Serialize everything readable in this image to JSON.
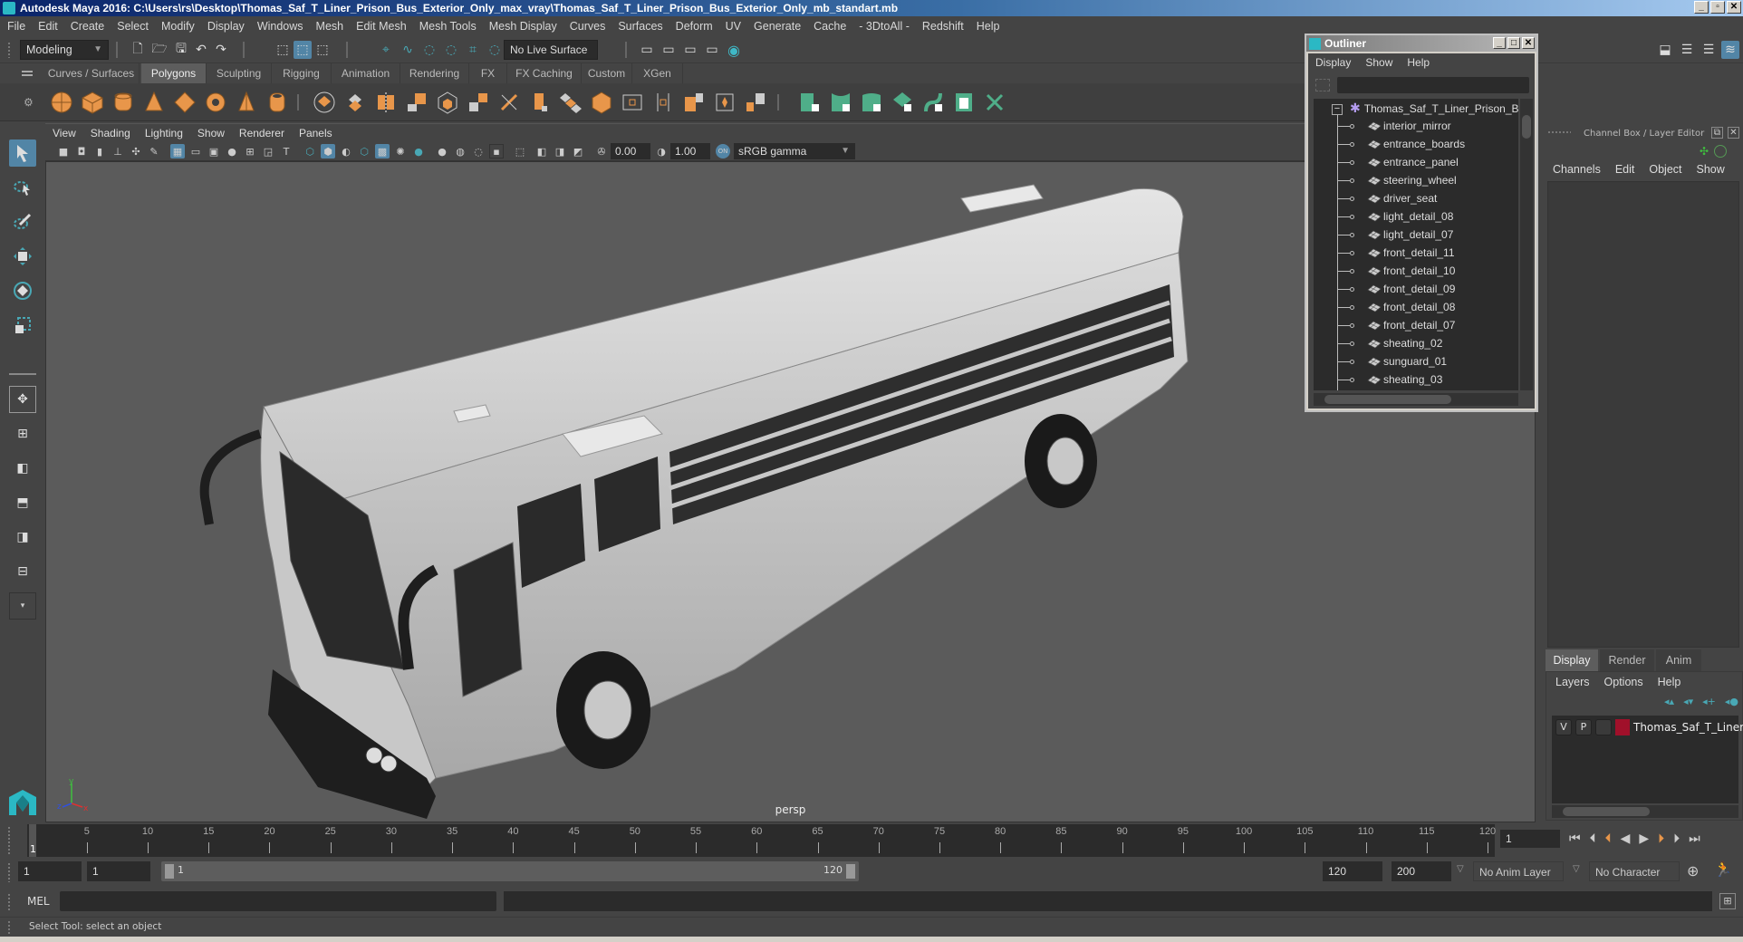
{
  "window": {
    "title": "Autodesk Maya 2016: C:\\Users\\rs\\Desktop\\Thomas_Saf_T_Liner_Prison_Bus_Exterior_Only_max_vray\\Thomas_Saf_T_Liner_Prison_Bus_Exterior_Only_mb_standart.mb",
    "buttons": [
      "_",
      "▫",
      "✕"
    ]
  },
  "menubar": [
    "File",
    "Edit",
    "Create",
    "Select",
    "Modify",
    "Display",
    "Windows",
    "Mesh",
    "Edit Mesh",
    "Mesh Tools",
    "Mesh Display",
    "Curves",
    "Surfaces",
    "Deform",
    "UV",
    "Generate",
    "Cache",
    "- 3DtoAll -",
    "Redshift",
    "Help"
  ],
  "statusline": {
    "mode": "Modeling",
    "live_surface": "No Live Surface"
  },
  "shelf": {
    "tabs": [
      "Curves / Surfaces",
      "Polygons",
      "Sculpting",
      "Rigging",
      "Animation",
      "Rendering",
      "FX",
      "FX Caching",
      "Custom",
      "XGen"
    ],
    "active_tab": "Polygons",
    "colors": {
      "orange": "#e8964a",
      "green": "#4fae89",
      "gray": "#c8c8c8"
    }
  },
  "viewport": {
    "menu": [
      "View",
      "Shading",
      "Lighting",
      "Show",
      "Renderer",
      "Panels"
    ],
    "exposure": "0.00",
    "gamma": "1.00",
    "color_space": "sRGB gamma",
    "camera_label": "persp",
    "axis": {
      "x": "x",
      "y": "y",
      "z": "z"
    }
  },
  "outliner": {
    "title": "Outliner",
    "menu": [
      "Display",
      "Show",
      "Help"
    ],
    "root": "Thomas_Saf_T_Liner_Prison_Bus_E",
    "items": [
      "interior_mirror",
      "entrance_boards",
      "entrance_panel",
      "steering_wheel",
      "driver_seat",
      "light_detail_08",
      "light_detail_07",
      "front_detail_11",
      "front_detail_10",
      "front_detail_09",
      "front_detail_08",
      "front_detail_07",
      "sheating_02",
      "sunguard_01",
      "sheating_03"
    ]
  },
  "channelbox": {
    "title": "Channel Box / Layer Editor",
    "menu": [
      "Channels",
      "Edit",
      "Object",
      "Show"
    ]
  },
  "layers": {
    "tabs": [
      "Display",
      "Render",
      "Anim"
    ],
    "active_tab": "Display",
    "menu": [
      "Layers",
      "Options",
      "Help"
    ],
    "rows": [
      {
        "v": "V",
        "p": "P",
        "color": "#a0102a",
        "name": "Thomas_Saf_T_Liner_Pr"
      }
    ]
  },
  "timeline": {
    "ticks": [
      5,
      10,
      15,
      20,
      25,
      30,
      35,
      40,
      45,
      50,
      55,
      60,
      65,
      70,
      75,
      80,
      85,
      90,
      95,
      100,
      105,
      110,
      115,
      120
    ],
    "start": 1,
    "end": 120,
    "current_frame": "1",
    "current_marker": "1"
  },
  "range": {
    "start_time": "1",
    "playback_start": "1",
    "range_start_label": "1",
    "range_end_label": "120",
    "playback_end": "120",
    "end_time": "200",
    "anim_layer": "No Anim Layer",
    "character_set": "No Character Set"
  },
  "command_line": {
    "label": "MEL",
    "value": ""
  },
  "help_line": "Select Tool: select an object"
}
